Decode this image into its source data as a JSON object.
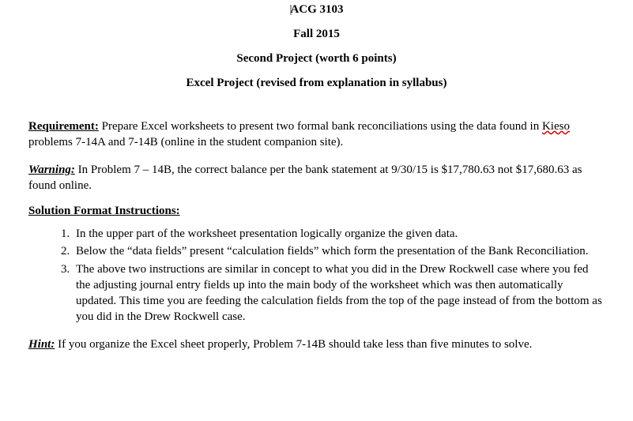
{
  "header": {
    "course": "ACG 3103",
    "term": "Fall 2015",
    "project_line": "Second Project (worth 6 points)",
    "subtitle": "Excel Project (revised from explanation in syllabus)"
  },
  "requirement": {
    "label": "Requirement:",
    "text_before_spellerr": "  Prepare Excel worksheets to present two formal bank reconciliations using the data found in ",
    "spellerr_word": "Kieso",
    "text_after_spellerr": " problems 7-14A and 7-14B (online in the student companion site)."
  },
  "warning": {
    "label": "Warning:",
    "text": "  In Problem 7 – 14B, the correct balance per the bank statement at 9/30/15 is $17,780.63 not $17,680.63 as found online."
  },
  "solution_format": {
    "heading": "Solution Format Instructions:",
    "items": [
      " In the upper part of the worksheet presentation logically organize the given data.",
      "Below the “data fields” present “calculation fields” which form the presentation of the Bank Reconciliation.",
      "The above two instructions are similar in concept to what you did in the Drew Rockwell case where you fed the adjusting journal entry fields up into the main body of the worksheet which was then automatically updated.  This time you are feeding the calculation fields from the top of the page instead of from the bottom as you did in the Drew Rockwell case."
    ]
  },
  "hint": {
    "label": "Hint:",
    "text": "  If you organize the Excel sheet properly, Problem 7-14B should take less than five minutes to solve."
  }
}
